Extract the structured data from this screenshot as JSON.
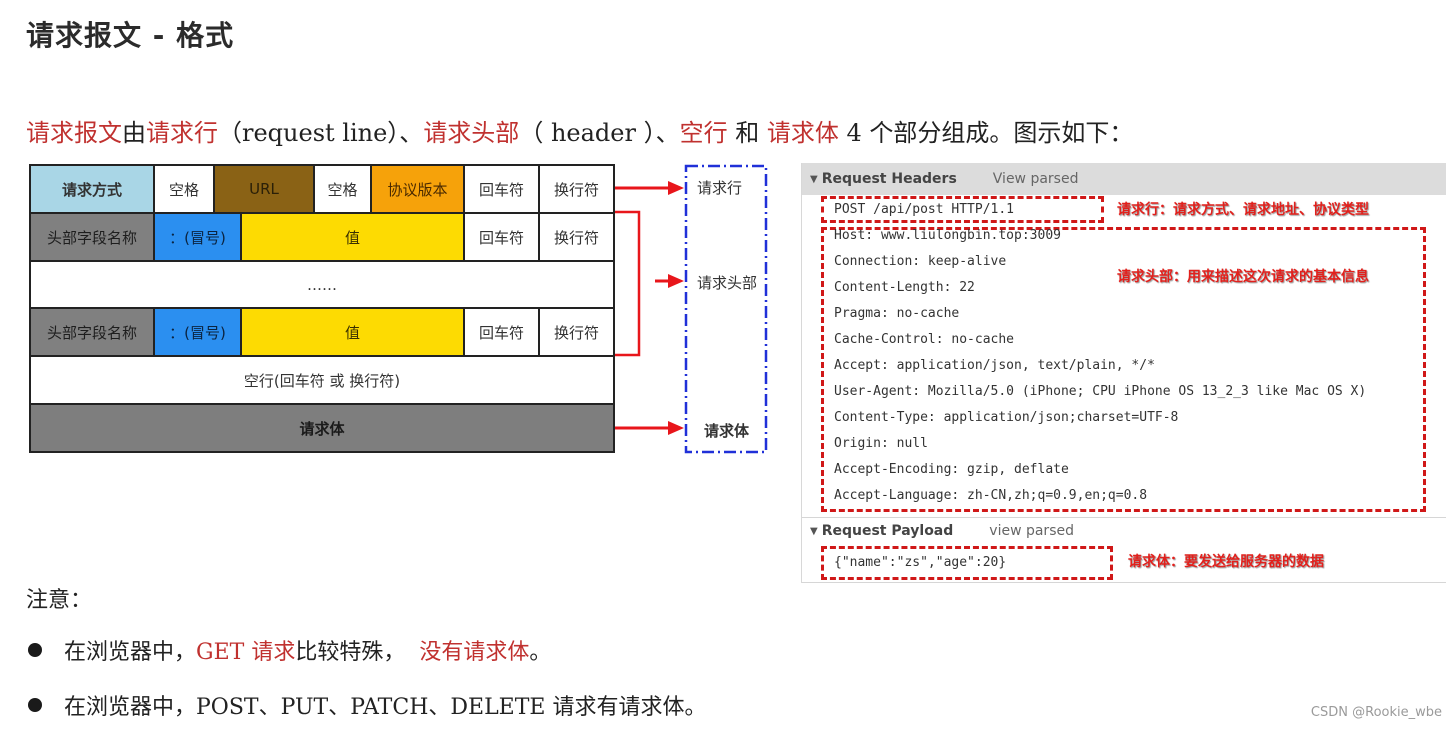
{
  "title": "请求报文 - 格式",
  "intro": {
    "parts": [
      {
        "text": "请求报文",
        "red": true
      },
      {
        "text": "由",
        "red": false
      },
      {
        "text": "请求行",
        "red": true
      },
      {
        "text": "（request line）、",
        "red": false
      },
      {
        "text": "请求头部",
        "red": true
      },
      {
        "text": "（ header ）、",
        "red": false
      },
      {
        "text": "空行",
        "red": true
      },
      {
        "text": " 和 ",
        "red": false
      },
      {
        "text": "请求体",
        "red": true
      },
      {
        "text": " 4 个部分组成。图示如下：",
        "red": false
      }
    ]
  },
  "diagram": {
    "row1": [
      "请求方式",
      "空格",
      "URL",
      "空格",
      "协议版本",
      "回车符",
      "换行符"
    ],
    "row2": [
      "头部字段名称",
      "：(冒号)",
      "值",
      "回车符",
      "换行符"
    ],
    "row3": "……",
    "row4": [
      "头部字段名称",
      "：(冒号)",
      "值",
      "回车符",
      "换行符"
    ],
    "row5": "空行(回车符 或 换行符)",
    "row6": "请求体",
    "labels": [
      "请求行",
      "请求头部",
      "请求体"
    ],
    "colors": {
      "method": "#a9d6e6",
      "url": "#8a6215",
      "protocol": "#f6a20a",
      "header_name": "#808080",
      "colon": "#2b8ff0",
      "value": "#fddb02",
      "body": "#7e7e7e",
      "arrow": "#e8161b",
      "bracket": "#2030d8"
    }
  },
  "devtools": {
    "headers_section": {
      "title": "Request Headers",
      "link": "View parsed"
    },
    "request_line": "POST /api/post HTTP/1.1",
    "headers": [
      "Host: www.liulongbin.top:3009",
      "Connection: keep-alive",
      "Content-Length: 22",
      "Pragma: no-cache",
      "Cache-Control: no-cache",
      "Accept: application/json, text/plain, */*",
      "User-Agent: Mozilla/5.0 (iPhone; CPU iPhone OS 13_2_3 like Mac OS X)",
      "Content-Type: application/json;charset=UTF-8",
      "Origin: null",
      "Accept-Encoding: gzip, deflate",
      "Accept-Language: zh-CN,zh;q=0.9,en;q=0.8"
    ],
    "payload_section": {
      "title": "Request Payload",
      "link": "view parsed"
    },
    "payload": "{\"name\":\"zs\",\"age\":20}",
    "annotations": {
      "request_line": "请求行：请求方式、请求地址、协议类型",
      "headers": "请求头部：用来描述这次请求的基本信息",
      "body": "请求体：要发送给服务器的数据"
    }
  },
  "notes": {
    "heading": "注意：",
    "bullets": [
      [
        {
          "text": "在浏览器中，",
          "red": false
        },
        {
          "text": "GET 请求",
          "red": true
        },
        {
          "text": "比较特殊，  ",
          "red": false
        },
        {
          "text": "没有请求体",
          "red": true
        },
        {
          "text": "。",
          "red": false
        }
      ],
      [
        {
          "text": "在浏览器中，POST、PUT、PATCH、DELETE 请求有请求体。",
          "red": false
        }
      ]
    ]
  },
  "watermark": "CSDN @Rookie_wbe"
}
